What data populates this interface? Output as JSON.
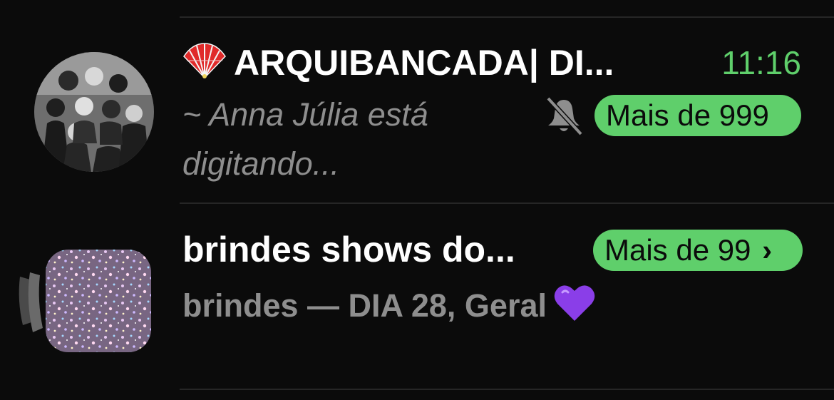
{
  "chats": [
    {
      "title": "ARQUIBANCADA| DI...",
      "time": "11:16",
      "preview_line1": "~ Anna Júlia está",
      "preview_line2": "digitando...",
      "badge": "Mais de 999",
      "icons": [
        "red-fan-emoji",
        "muted-bell-icon",
        "group-photo-avatar"
      ]
    },
    {
      "title": "brindes shows do...",
      "badge": "Mais de 99",
      "badge_chevron": "›",
      "preview": "brindes — DIA 28, Geral",
      "icons": [
        "community-stack-avatar",
        "purple-heart-emoji",
        "chevron-right-icon"
      ]
    }
  ],
  "colors": {
    "background": "#0b0b0b",
    "accent_green": "#5fcf6b",
    "secondary_text": "#8e8e8e",
    "divider": "#262626",
    "purple_heart": "#8a3ee8"
  }
}
